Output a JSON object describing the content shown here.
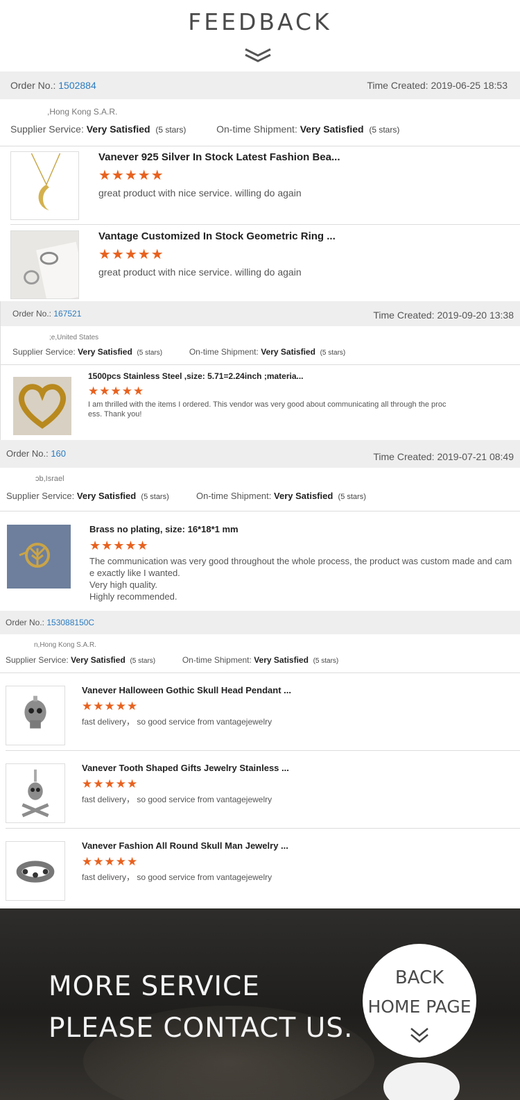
{
  "header": {
    "title": "FEEDBACK"
  },
  "orders": [
    {
      "order_label": "Order No.:",
      "order_no": "1502884",
      "time_label": "Time Created:",
      "time": "2019-06-25 18:53",
      "location": ",Hong Kong S.A.R.",
      "supplier_label": "Supplier Service:",
      "supplier_value": "Very Satisfied",
      "supplier_stars": "(5 stars)",
      "shipment_label": "On-time Shipment:",
      "shipment_value": "Very Satisfied",
      "shipment_stars": "(5 stars)",
      "items": [
        {
          "title": "Vanever 925 Silver In Stock Latest Fashion Bea...",
          "rating": 5,
          "stars": "★★★★★",
          "review": "great product with nice service. willing do again",
          "image_icon": "moon-necklace-image"
        },
        {
          "title": "Vantage Customized In Stock Geometric Ring ...",
          "rating": 5,
          "stars": "★★★★★",
          "review": "great product with nice service. willing do again",
          "image_icon": "geometric-ring-image"
        }
      ]
    },
    {
      "order_label": "Order No.:",
      "order_no": "167521",
      "time_label": "Time Created:",
      "time": "2019-09-20 13:38",
      "location": ";e,United States",
      "supplier_label": "Supplier Service:",
      "supplier_value": "Very Satisfied",
      "supplier_stars": "(5 stars)",
      "shipment_label": "On-time Shipment:",
      "shipment_value": "Very Satisfied",
      "shipment_stars": "(5 stars)",
      "items": [
        {
          "title": "1500pcs Stainless Steel ,size: 5.71=2.24inch ;materia...",
          "rating": 5,
          "stars": "★★★★★",
          "review_line1": "I am thrilled with the items I ordered.  This vendor was very good about communicating all through the proc",
          "review_line2": "ess. Thank you!",
          "image_icon": "heart-pendant-image"
        }
      ]
    },
    {
      "order_label": "Order No.:",
      "order_no": "160",
      "time_label": "Time Created:",
      "time": "2019-07-21 08:49",
      "location": "ɔb,Israel",
      "supplier_label": "Supplier Service:",
      "supplier_value": "Very Satisfied",
      "supplier_stars": "(5 stars)",
      "shipment_label": "On-time Shipment:",
      "shipment_value": "Very Satisfied",
      "shipment_stars": "(5 stars)",
      "items": [
        {
          "title": "Brass no plating, size: 16*18*1 mm",
          "rating": 5,
          "stars": "★★★★★",
          "review_line1": "The communication was very good throughout the whole process, the product was custom made and cam",
          "review_line2": "e exactly like I wanted.",
          "review_line3": "Very high quality.",
          "review_line4": "Highly recommended.",
          "image_icon": "tree-of-life-pendant-image"
        }
      ]
    },
    {
      "order_label": "Order No.:",
      "order_no": "153088150C",
      "location": "n,Hong Kong S.A.R.",
      "supplier_label": "Supplier Service:",
      "supplier_value": "Very Satisfied",
      "supplier_stars": "(5 stars)",
      "shipment_label": "On-time Shipment:",
      "shipment_value": "Very Satisfied",
      "shipment_stars": "(5 stars)",
      "items": [
        {
          "title": "Vanever Halloween Gothic Skull Head Pendant ...",
          "rating": 5,
          "stars": "★★★★★",
          "review": "fast delivery， so good service from vantagejewelry",
          "image_icon": "skull-pendant-image"
        },
        {
          "title": "Vanever Tooth Shaped Gifts Jewelry Stainless ...",
          "rating": 5,
          "stars": "★★★★★",
          "review": "fast delivery， so good service from vantagejewelry",
          "image_icon": "skull-crossbones-pendant-image"
        },
        {
          "title": "Vanever Fashion All Round Skull Man Jewelry ...",
          "rating": 5,
          "stars": "★★★★★",
          "review": "fast delivery， so good service from vantagejewelry",
          "image_icon": "skull-ring-image"
        }
      ]
    }
  ],
  "footer": {
    "line1": "MORE SERVICE",
    "line2": "PLEASE CONTACT US.",
    "back_line1": "BACK",
    "back_line2": "HOME PAGE"
  },
  "colors": {
    "accent_star": "#e8611e",
    "order_link": "#2b7bc0",
    "bar_bg": "#eeeeee",
    "footer_bg": "#24231f"
  }
}
